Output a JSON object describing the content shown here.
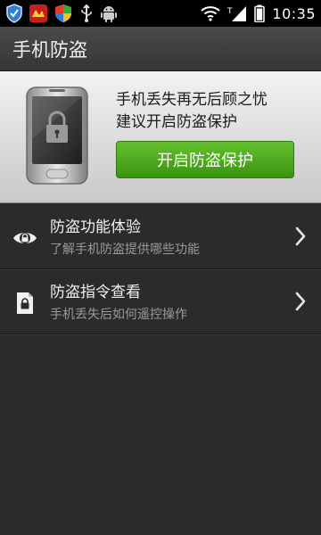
{
  "status_bar": {
    "time": "10:35",
    "icons": [
      "shield-icon",
      "red-app-icon",
      "colorful-shield-icon",
      "usb-icon",
      "android-icon",
      "wifi-icon",
      "signal-icon",
      "battery-icon"
    ]
  },
  "header": {
    "title": "手机防盗"
  },
  "promo": {
    "line1": "手机丢失再无后顾之忧",
    "line2": "建议开启防盗保护",
    "button_label": "开启防盗保护",
    "button_color": "#4aa81c"
  },
  "list": {
    "items": [
      {
        "title": "防盗功能体验",
        "subtitle": "了解手机防盗提供哪些功能",
        "icon": "eye-lock-icon"
      },
      {
        "title": "防盗指令查看",
        "subtitle": "手机丢失后如何遥控操作",
        "icon": "document-lock-icon"
      }
    ]
  }
}
